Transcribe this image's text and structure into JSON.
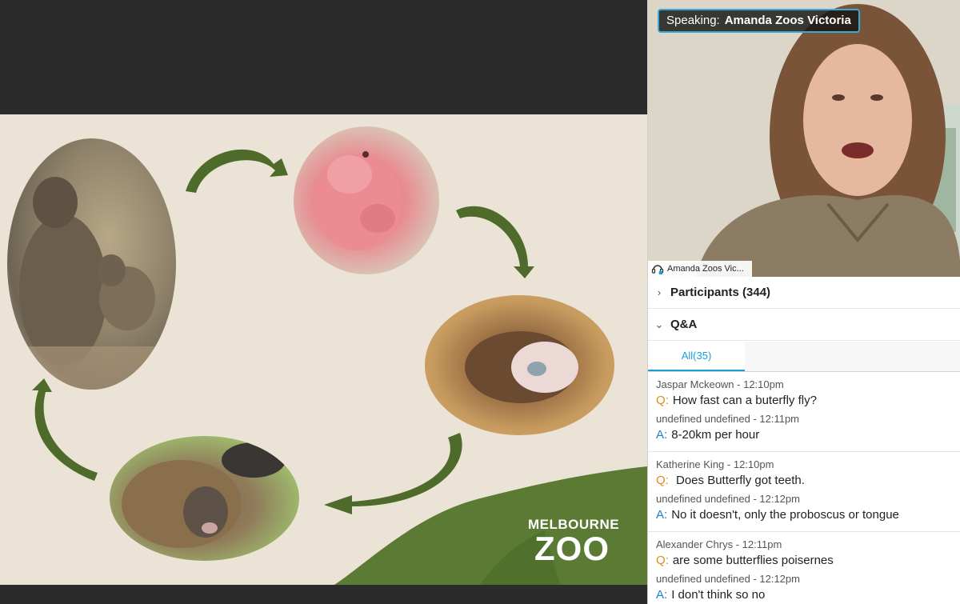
{
  "slide": {
    "logo_line1": "MELBOURNE",
    "logo_line2": "ZOO",
    "photos": [
      "wallaby-mother-joey-photo",
      "embryo-photo",
      "pouch-joey-photo",
      "joey-in-pouch-photo"
    ],
    "colors": {
      "background": "#ebe4d6",
      "arrow": "#4e6b2c",
      "hill": "#5b7a34"
    }
  },
  "video": {
    "speaking_label": "Speaking:",
    "speaker_name": "Amanda Zoos Victoria",
    "name_tag": "Amanda Zoos Vic..."
  },
  "panel": {
    "participants_label": "Participants (344)",
    "qa_label": "Q&A",
    "tab_all": "All(35)"
  },
  "qa": [
    {
      "asker": "Jaspar Mckeown - 12:10pm",
      "q_tag": "Q:",
      "question": "How fast can a buterfly fly?",
      "answerer": "undefined undefined - 12:11pm",
      "a_tag": "A:",
      "answer": "8-20km per hour"
    },
    {
      "asker": "Katherine King - 12:10pm",
      "q_tag": "Q:",
      "question": " Does Butterfly got teeth.",
      "answerer": "undefined undefined - 12:12pm",
      "a_tag": "A:",
      "answer": "No it doesn't, only the proboscus or tongue"
    },
    {
      "asker": "Alexander Chrys - 12:11pm",
      "q_tag": "Q:",
      "question": "are some butterflies poisernes",
      "answerer": "undefined undefined - 12:12pm",
      "a_tag": "A:",
      "answer": "I don't think so no"
    }
  ],
  "colors": {
    "accent": "#1a9ed8",
    "question_tag": "#e0891b",
    "answer_tag": "#1a7fc6",
    "speaking_border": "#39a9d6"
  }
}
